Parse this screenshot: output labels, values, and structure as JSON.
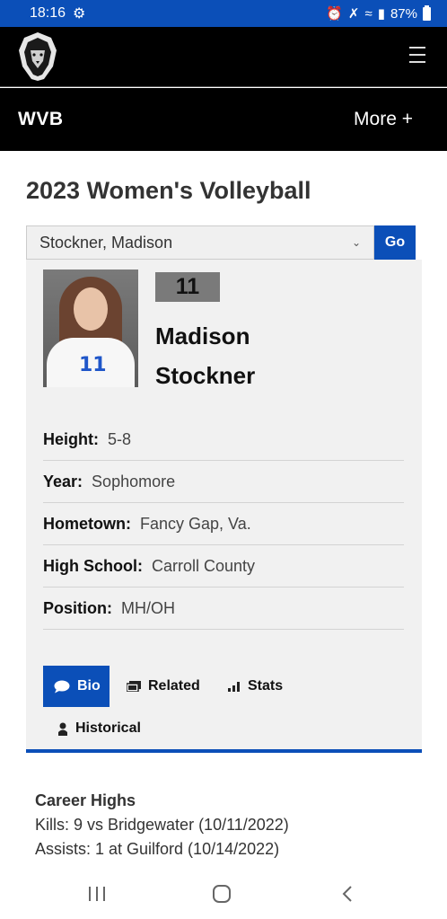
{
  "status_bar": {
    "time": "18:16",
    "battery": "87%",
    "icons": [
      "alarm-icon",
      "mute-icon",
      "wifi-icon",
      "signal-icon",
      "battery-icon"
    ]
  },
  "header": {
    "logo_icon": "lion-logo-icon",
    "menu_icon": "hamburger-menu-icon"
  },
  "section_bar": {
    "title": "WVB",
    "more_label": "More +"
  },
  "page": {
    "title": "2023 Women's Volleyball"
  },
  "roster_select": {
    "selected": "Stockner, Madison",
    "go_label": "Go"
  },
  "player": {
    "jersey_number": "11",
    "first_name": "Madison",
    "last_name": "Stockner",
    "photo_jersey_number": "11",
    "details": [
      {
        "label": "Height:",
        "value": "5-8"
      },
      {
        "label": "Year:",
        "value": "Sophomore"
      },
      {
        "label": "Hometown:",
        "value": "Fancy Gap, Va."
      },
      {
        "label": "High School:",
        "value": "Carroll County"
      },
      {
        "label": "Position:",
        "value": "MH/OH"
      }
    ]
  },
  "tabs": [
    {
      "label": "Bio",
      "icon": "chat-bubble-icon",
      "active": true
    },
    {
      "label": "Related",
      "icon": "related-icon",
      "active": false
    },
    {
      "label": "Stats",
      "icon": "bar-chart-icon",
      "active": false
    },
    {
      "label": "Historical",
      "icon": "person-icon",
      "active": false
    }
  ],
  "career_highs": {
    "heading": "Career Highs",
    "lines": [
      "Kills: 9 vs Bridgewater (10/11/2022)",
      "Assists: 1 at Guilford (10/14/2022)"
    ]
  },
  "colors": {
    "accent": "#0b4fb8",
    "header_bg": "#000000",
    "card_bg": "#f1f1f1"
  }
}
